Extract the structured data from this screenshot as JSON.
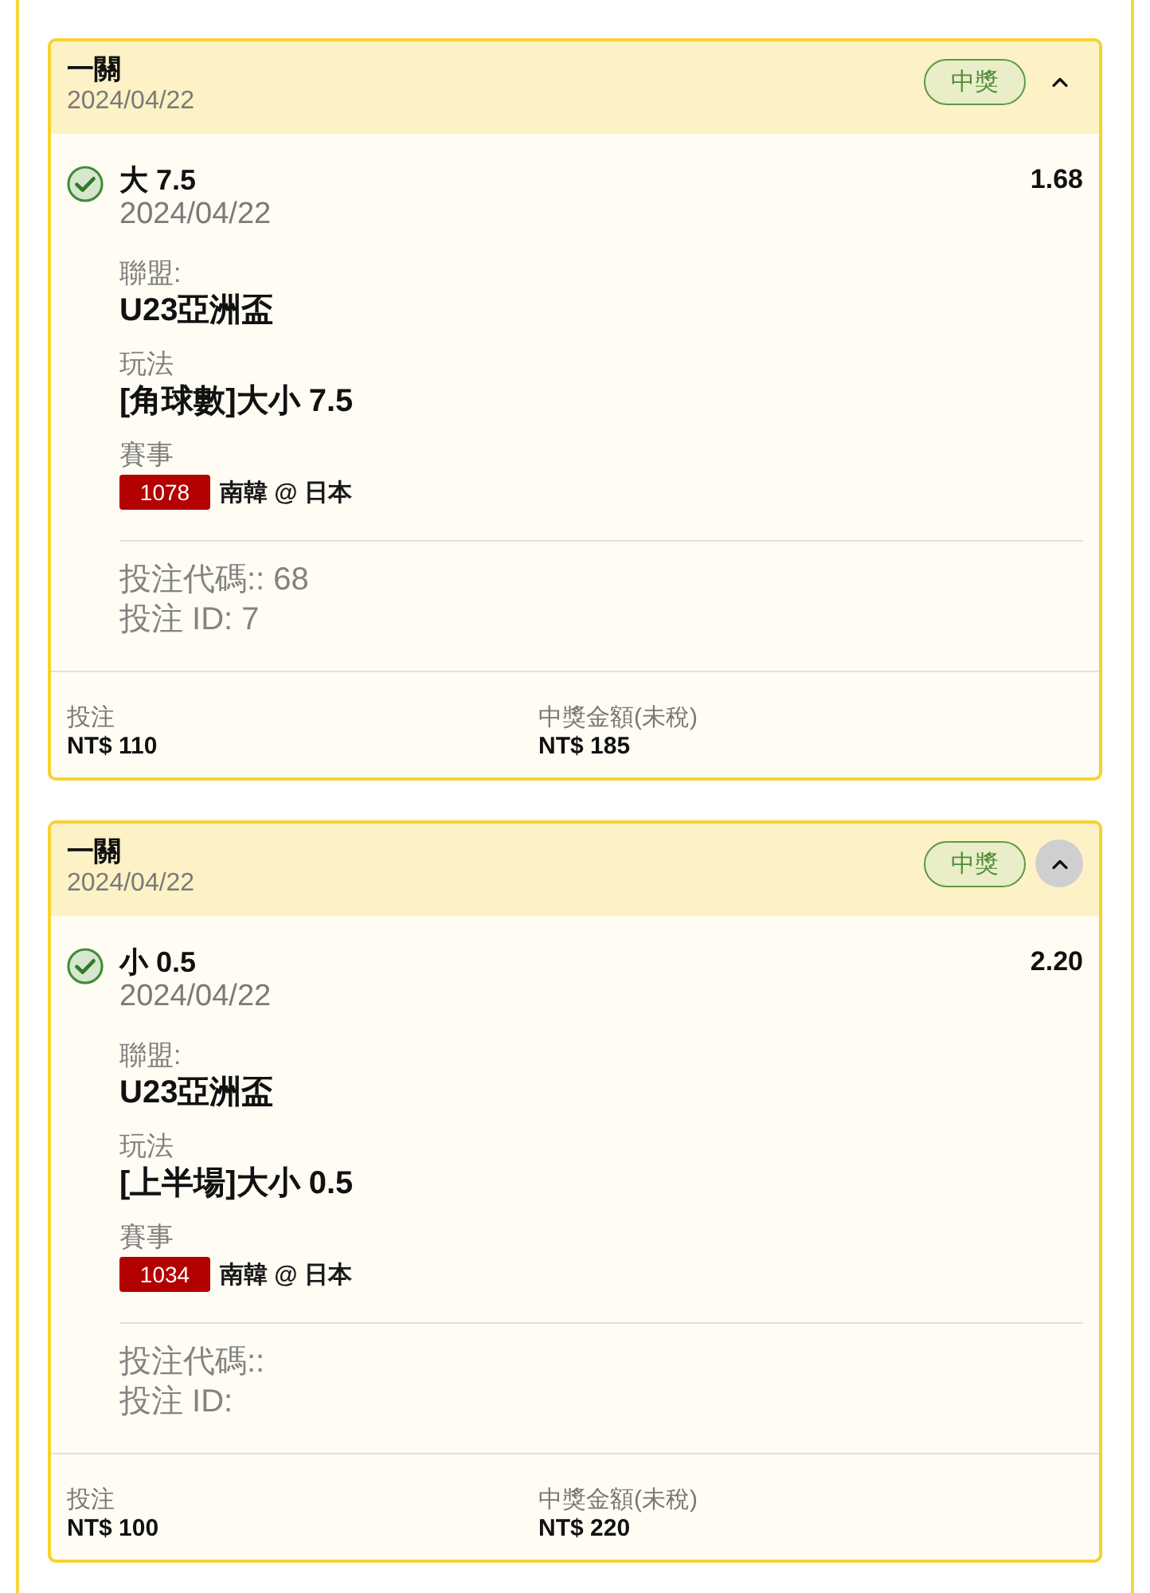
{
  "bets": [
    {
      "header": {
        "title": "一關",
        "date": "2024/04/22",
        "status_badge": "中獎",
        "collapse_button": {
          "expanded": true,
          "focused": false
        }
      },
      "selection": {
        "won": true,
        "name": "大 7.5",
        "date": "2024/04/22",
        "odds": "1.68"
      },
      "details": [
        {
          "label": "聯盟:",
          "value": "U23亞洲盃"
        },
        {
          "label": "玩法",
          "value": "[角球數]大小 7.5"
        }
      ],
      "match": {
        "label": "賽事",
        "code": "1078",
        "teams": "南韓 @ 日本"
      },
      "references": [
        "投注代碼:: 68",
        "投注 ID: 7"
      ],
      "footer": [
        {
          "label": "投注",
          "value": "NT$ 110"
        },
        {
          "label": "中獎金額(未稅)",
          "value": "NT$ 185"
        }
      ]
    },
    {
      "header": {
        "title": "一關",
        "date": "2024/04/22",
        "status_badge": "中獎",
        "collapse_button": {
          "expanded": true,
          "focused": true
        }
      },
      "selection": {
        "won": true,
        "name": "小 0.5",
        "date": "2024/04/22",
        "odds": "2.20"
      },
      "details": [
        {
          "label": "聯盟:",
          "value": "U23亞洲盃"
        },
        {
          "label": "玩法",
          "value": "[上半場]大小 0.5"
        }
      ],
      "match": {
        "label": "賽事",
        "code": "1034",
        "teams": "南韓 @ 日本"
      },
      "references": [
        "投注代碼::",
        "投注 ID:"
      ],
      "footer": [
        {
          "label": "投注",
          "value": "NT$ 100"
        },
        {
          "label": "中獎金額(未稅)",
          "value": "NT$ 220"
        }
      ]
    }
  ]
}
